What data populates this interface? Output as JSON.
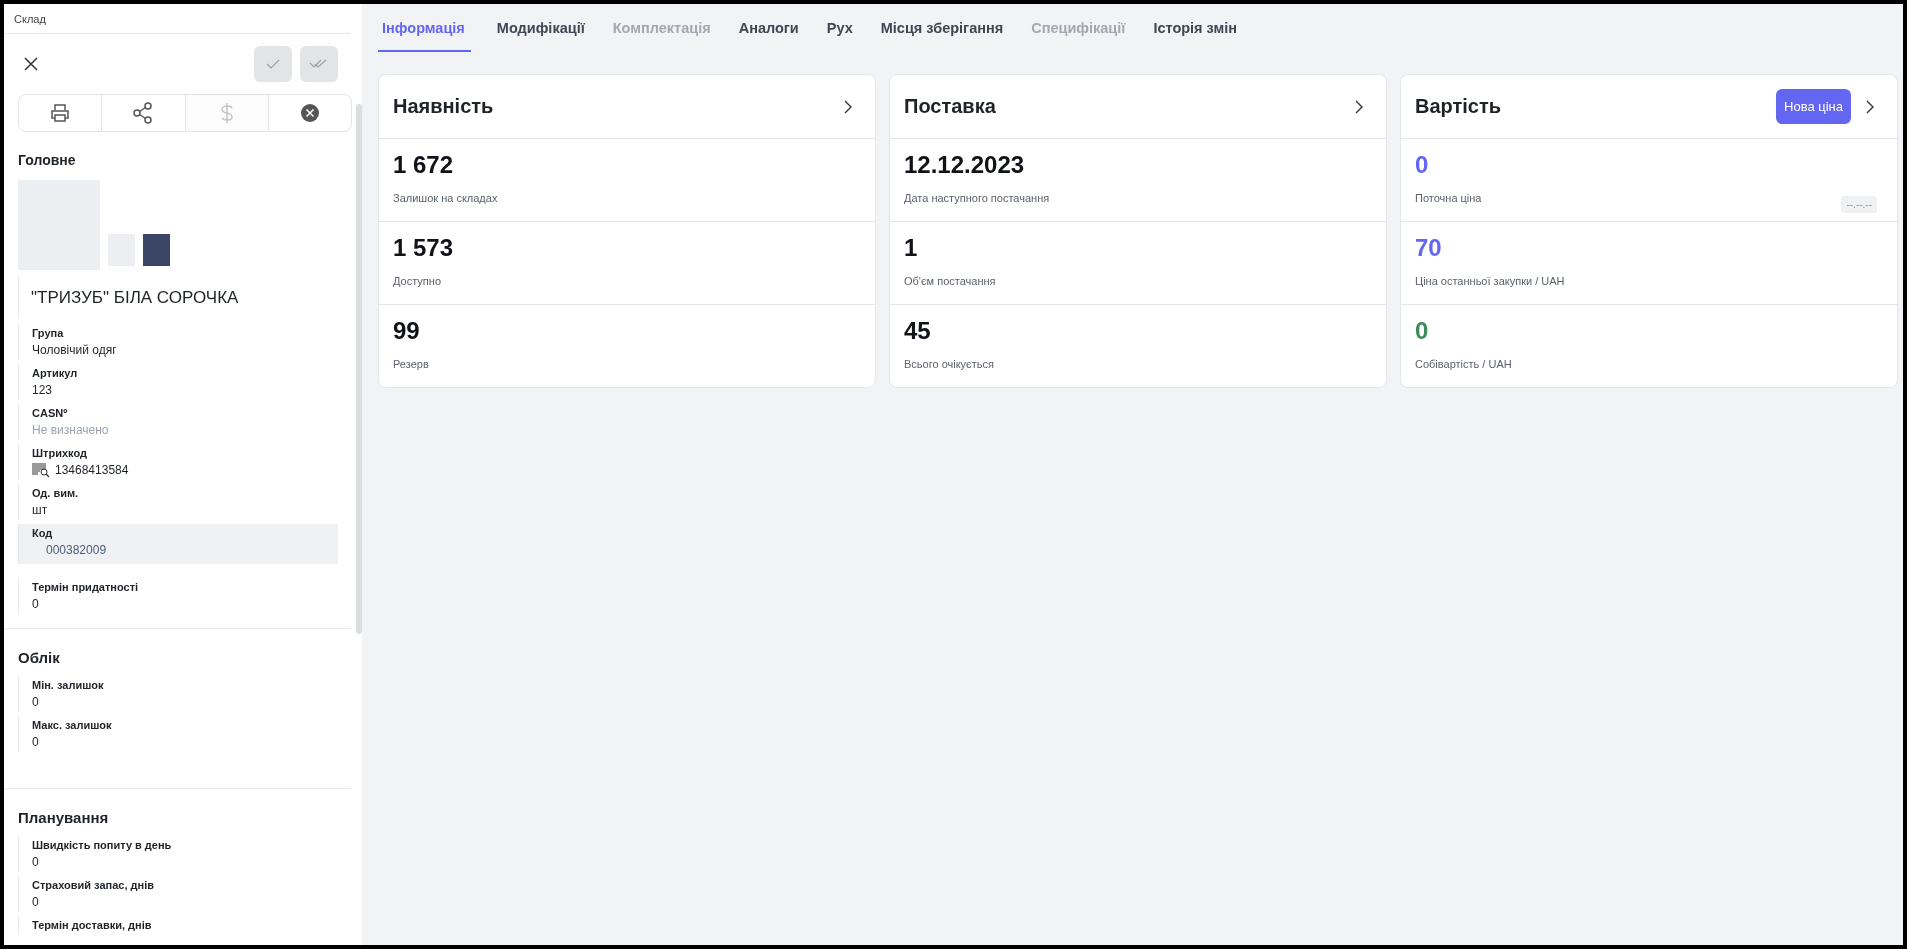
{
  "breadcrumb": "Склад",
  "toolbar": {
    "confirm_disabled": true,
    "confirm_all_disabled": true
  },
  "actions": [
    {
      "kind": "print",
      "disabled": false
    },
    {
      "kind": "share",
      "disabled": false
    },
    {
      "kind": "price",
      "disabled": true
    },
    {
      "kind": "cancel",
      "disabled": false
    }
  ],
  "sections": [
    {
      "title": "Головне",
      "product_name": "\"ТРИЗУБ\" БІЛА СОРОЧКА",
      "fields": [
        {
          "kind": "text",
          "label": "Група",
          "value": "Чоловічий одяг"
        },
        {
          "kind": "text",
          "label": "Артикул",
          "value": "123"
        },
        {
          "kind": "unset",
          "label": "CASN",
          "label_sup": "º",
          "value": "Не визначено"
        },
        {
          "kind": "barcode",
          "label": "Штрихкод",
          "value": "13468413584"
        },
        {
          "kind": "text",
          "label": "Од. вим.",
          "value": "шт"
        },
        {
          "kind": "code",
          "label": "Код",
          "value": "000382009"
        },
        {
          "kind": "text",
          "label": "Термін придатності",
          "value": "0"
        }
      ]
    },
    {
      "title": "Облік",
      "fields": [
        {
          "kind": "text",
          "label": "Мін. залишок",
          "value": "0"
        },
        {
          "kind": "text",
          "label": "Макс. залишок",
          "value": "0"
        }
      ]
    },
    {
      "title": "Планування",
      "fields": [
        {
          "kind": "text",
          "label": "Швидкість попиту в день",
          "value": "0"
        },
        {
          "kind": "text",
          "label": "Страховий запас, днів",
          "value": "0"
        },
        {
          "kind": "text",
          "label": "Термін доставки, днів"
        }
      ]
    }
  ],
  "tabs": [
    {
      "label": "Інформація",
      "selected": true,
      "disabled": false
    },
    {
      "label": "Модифікації",
      "selected": false,
      "disabled": false
    },
    {
      "label": "Комплектація",
      "selected": false,
      "disabled": true
    },
    {
      "label": "Аналоги",
      "selected": false,
      "disabled": false
    },
    {
      "label": "Рух",
      "selected": false,
      "disabled": false
    },
    {
      "label": "Місця зберігання",
      "selected": false,
      "disabled": false
    },
    {
      "label": "Специфікації",
      "selected": false,
      "disabled": true
    },
    {
      "label": "Історія змін",
      "selected": false,
      "disabled": false
    }
  ],
  "cards": [
    {
      "title": "Наявність",
      "stats": [
        {
          "value": "1 672",
          "label": "Залишок на складах"
        },
        {
          "value": "1 573",
          "label": "Доступно"
        },
        {
          "value": "99",
          "label": "Резерв"
        }
      ]
    },
    {
      "title": "Поставка",
      "stats": [
        {
          "value": "12.12.2023",
          "label": "Дата наступного постачання"
        },
        {
          "value": "1",
          "label": "Об'єм постачання"
        },
        {
          "value": "45",
          "label": "Всього очікується"
        }
      ]
    },
    {
      "title": "Вартість",
      "button": "Нова ціна",
      "stats": [
        {
          "value": "0",
          "label": "Поточна ціна",
          "color": "#6366f1",
          "badge": "--.--.--"
        },
        {
          "value": "70",
          "label": "Ціна останньої закупки / UAH",
          "color": "#6366f1"
        },
        {
          "value": "0",
          "label": "Собівартість / UAH",
          "color": "#3d8b5a"
        }
      ]
    }
  ]
}
